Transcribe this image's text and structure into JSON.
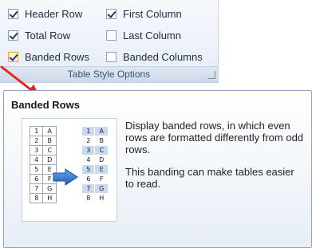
{
  "ribbon": {
    "group_label": "Table Style Options",
    "options": [
      {
        "label": "Header Row",
        "checked": true
      },
      {
        "label": "First Column",
        "checked": true
      },
      {
        "label": "Total Row",
        "checked": true
      },
      {
        "label": "Last Column",
        "checked": false
      },
      {
        "label": "Banded Rows",
        "checked": true
      },
      {
        "label": "Banded Columns",
        "checked": false
      }
    ]
  },
  "tooltip": {
    "title": "Banded Rows",
    "description_1": "Display banded rows, in which even rows are formatted differently from odd rows.",
    "description_2": "This banding can make tables easier to read.",
    "preview": {
      "rows": [
        [
          "1",
          "A"
        ],
        [
          "2",
          "B"
        ],
        [
          "3",
          "C"
        ],
        [
          "4",
          "D"
        ],
        [
          "5",
          "E"
        ],
        [
          "6",
          "F"
        ],
        [
          "7",
          "G"
        ],
        [
          "8",
          "H"
        ]
      ]
    }
  },
  "colors": {
    "annotation_arrow": "#e8231e",
    "banding": "#c9daef",
    "transition_arrow": "#3d7fd0"
  },
  "icons": [
    "checkbox-icon",
    "dialog-launcher-icon",
    "red-annotation-arrow-icon",
    "blue-transition-arrow-icon"
  ]
}
